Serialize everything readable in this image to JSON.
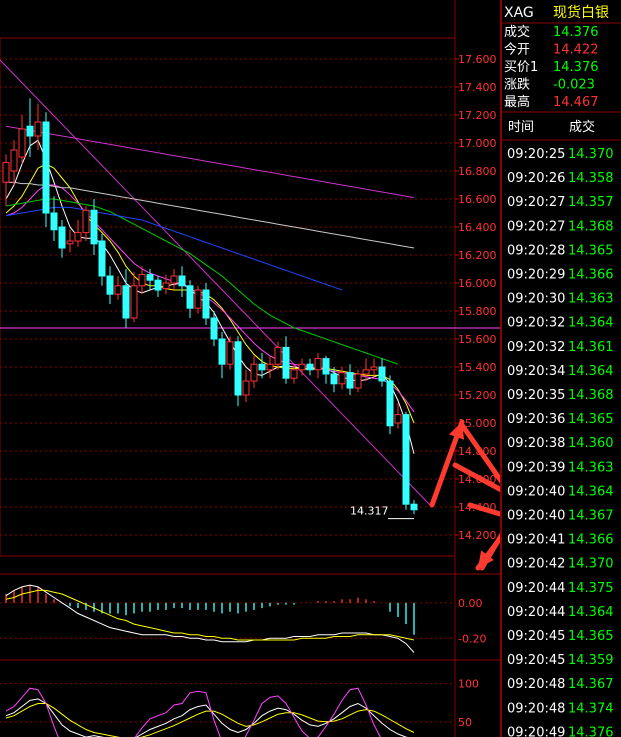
{
  "header": {
    "symbol": "XAG",
    "name": "现货白银"
  },
  "quote": [
    {
      "label": "成交",
      "value": "14.376",
      "color": "#00ff00"
    },
    {
      "label": "今开",
      "value": "14.422",
      "color": "#ff3333"
    },
    {
      "label": "买价1",
      "value": "14.376",
      "color": "#00ff00"
    },
    {
      "label": "涨跌",
      "value": "-0.023",
      "color": "#00ff00"
    },
    {
      "label": "最高",
      "value": "14.467",
      "color": "#ff3333"
    }
  ],
  "ticks": {
    "col_time": "时间",
    "col_price": "成交",
    "rows": [
      {
        "time": "09:20:25",
        "price": "14.370"
      },
      {
        "time": "09:20:26",
        "price": "14.358"
      },
      {
        "time": "09:20:27",
        "price": "14.357"
      },
      {
        "time": "09:20:27",
        "price": "14.368"
      },
      {
        "time": "09:20:28",
        "price": "14.365"
      },
      {
        "time": "09:20:29",
        "price": "14.366"
      },
      {
        "time": "09:20:30",
        "price": "14.363"
      },
      {
        "time": "09:20:32",
        "price": "14.364"
      },
      {
        "time": "09:20:32",
        "price": "14.361"
      },
      {
        "time": "09:20:34",
        "price": "14.364"
      },
      {
        "time": "09:20:35",
        "price": "14.368"
      },
      {
        "time": "09:20:36",
        "price": "14.365"
      },
      {
        "time": "09:20:38",
        "price": "14.360"
      },
      {
        "time": "09:20:39",
        "price": "14.363"
      },
      {
        "time": "09:20:40",
        "price": "14.364"
      },
      {
        "time": "09:20:40",
        "price": "14.367"
      },
      {
        "time": "09:20:41",
        "price": "14.366"
      },
      {
        "time": "09:20:42",
        "price": "14.370"
      },
      {
        "time": "09:20:44",
        "price": "14.375"
      },
      {
        "time": "09:20:44",
        "price": "14.364"
      },
      {
        "time": "09:20:45",
        "price": "14.365"
      },
      {
        "time": "09:20:45",
        "price": "14.359"
      },
      {
        "time": "09:20:48",
        "price": "14.367"
      },
      {
        "time": "09:20:48",
        "price": "14.374"
      },
      {
        "time": "09:20:49",
        "price": "14.376"
      }
    ]
  },
  "chart_data": {
    "type": "candlestick",
    "ylim": [
      14.05,
      17.75
    ],
    "y_ticks": [
      "17.600",
      "17.400",
      "17.200",
      "17.000",
      "16.800",
      "16.600",
      "16.400",
      "16.200",
      "16.000",
      "15.800",
      "15.600",
      "15.400",
      "15.200",
      "15.000",
      "14.800",
      "14.600",
      "14.400",
      "14.200"
    ],
    "last_price_label": "14.317",
    "candles": [
      [
        16.72,
        16.86,
        16.55,
        16.92
      ],
      [
        16.8,
        16.95,
        16.7,
        17.02
      ],
      [
        16.9,
        17.1,
        16.85,
        17.2
      ],
      [
        17.12,
        17.05,
        16.9,
        17.32
      ],
      [
        17.05,
        17.15,
        16.95,
        17.28
      ],
      [
        17.15,
        16.5,
        16.4,
        17.22
      ],
      [
        16.5,
        16.38,
        16.3,
        16.62
      ],
      [
        16.4,
        16.25,
        16.18,
        16.45
      ],
      [
        16.28,
        16.3,
        16.22,
        16.38
      ],
      [
        16.3,
        16.36,
        16.26,
        16.45
      ],
      [
        16.36,
        16.52,
        16.3,
        16.55
      ],
      [
        16.52,
        16.28,
        16.2,
        16.6
      ],
      [
        16.3,
        16.05,
        15.98,
        16.35
      ],
      [
        16.05,
        15.92,
        15.85,
        16.12
      ],
      [
        15.92,
        15.98,
        15.88,
        16.05
      ],
      [
        15.98,
        15.75,
        15.68,
        16.1
      ],
      [
        15.75,
        15.98,
        15.72,
        16.08
      ],
      [
        15.98,
        16.06,
        15.92,
        16.12
      ],
      [
        16.06,
        16.02,
        15.95,
        16.1
      ],
      [
        16.02,
        15.95,
        15.9,
        16.05
      ],
      [
        15.96,
        16.0,
        15.92,
        16.06
      ],
      [
        16.0,
        16.05,
        15.95,
        16.1
      ],
      [
        16.05,
        15.98,
        15.9,
        16.12
      ],
      [
        15.98,
        15.82,
        15.75,
        16.02
      ],
      [
        15.82,
        15.95,
        15.78,
        15.98
      ],
      [
        15.95,
        15.75,
        15.7,
        16.0
      ],
      [
        15.75,
        15.6,
        15.55,
        15.8
      ],
      [
        15.6,
        15.42,
        15.32,
        15.65
      ],
      [
        15.42,
        15.58,
        15.38,
        15.62
      ],
      [
        15.58,
        15.2,
        15.12,
        15.62
      ],
      [
        15.2,
        15.3,
        15.15,
        15.38
      ],
      [
        15.3,
        15.42,
        15.25,
        15.48
      ],
      [
        15.42,
        15.38,
        15.32,
        15.5
      ],
      [
        15.38,
        15.42,
        15.32,
        15.48
      ],
      [
        15.42,
        15.54,
        15.38,
        15.58
      ],
      [
        15.54,
        15.32,
        15.28,
        15.62
      ],
      [
        15.32,
        15.38,
        15.28,
        15.42
      ],
      [
        15.38,
        15.42,
        15.34,
        15.46
      ],
      [
        15.42,
        15.38,
        15.34,
        15.46
      ],
      [
        15.38,
        15.46,
        15.32,
        15.5
      ],
      [
        15.46,
        15.35,
        15.28,
        15.48
      ],
      [
        15.35,
        15.28,
        15.22,
        15.4
      ],
      [
        15.28,
        15.36,
        15.24,
        15.4
      ],
      [
        15.36,
        15.25,
        15.2,
        15.42
      ],
      [
        15.25,
        15.35,
        15.22,
        15.38
      ],
      [
        15.35,
        15.38,
        15.3,
        15.46
      ],
      [
        15.38,
        15.4,
        15.32,
        15.46
      ],
      [
        15.4,
        15.3,
        15.26,
        15.46
      ],
      [
        15.3,
        14.98,
        14.92,
        15.34
      ],
      [
        15.0,
        15.06,
        14.96,
        15.14
      ],
      [
        15.06,
        14.42,
        14.38,
        15.08
      ],
      [
        14.42,
        14.38,
        14.35,
        14.45
      ]
    ],
    "ma_lines": [
      {
        "color": "#ffffff",
        "values": [
          16.6,
          16.7,
          16.85,
          16.98,
          17.02,
          16.88,
          16.72,
          16.55,
          16.4,
          16.33,
          16.32,
          16.32,
          16.28,
          16.2,
          16.1,
          16.0,
          15.95,
          15.93,
          15.95,
          15.97,
          15.98,
          15.99,
          16.0,
          15.96,
          15.9,
          15.86,
          15.79,
          15.68,
          15.58,
          15.48,
          15.4,
          15.35,
          15.34,
          15.37,
          15.4,
          15.41,
          15.4,
          15.39,
          15.38,
          15.39,
          15.39,
          15.36,
          15.33,
          15.31,
          15.3,
          15.31,
          15.33,
          15.35,
          15.28,
          15.16,
          15.0,
          14.78
        ]
      },
      {
        "color": "#ffff00",
        "values": [
          16.5,
          16.55,
          16.62,
          16.72,
          16.82,
          16.85,
          16.82,
          16.75,
          16.68,
          16.58,
          16.48,
          16.42,
          16.36,
          16.3,
          16.22,
          16.12,
          16.05,
          16.0,
          15.98,
          15.98,
          15.96,
          15.95,
          15.95,
          15.95,
          15.94,
          15.92,
          15.88,
          15.82,
          15.74,
          15.65,
          15.56,
          15.49,
          15.44,
          15.41,
          15.4,
          15.39,
          15.39,
          15.39,
          15.39,
          15.39,
          15.39,
          15.38,
          15.37,
          15.36,
          15.35,
          15.34,
          15.34,
          15.34,
          15.31,
          15.24,
          15.14,
          15.0
        ]
      },
      {
        "color": "#ff44ff",
        "values": [
          16.48,
          16.5,
          16.54,
          16.6,
          16.66,
          16.7,
          16.7,
          16.68,
          16.63,
          16.57,
          16.5,
          16.44,
          16.38,
          16.32,
          16.26,
          16.2,
          16.14,
          16.1,
          16.07,
          16.05,
          16.03,
          16.01,
          15.99,
          15.96,
          15.93,
          15.9,
          15.86,
          15.81,
          15.75,
          15.69,
          15.63,
          15.57,
          15.52,
          15.48,
          15.45,
          15.43,
          15.42,
          15.41,
          15.4,
          15.39,
          15.38,
          15.37,
          15.36,
          15.35,
          15.34,
          15.33,
          15.32,
          15.31,
          15.28,
          15.23,
          15.16,
          15.08
        ]
      },
      {
        "color": "#00cc00",
        "values": [
          16.55,
          16.56,
          16.57,
          16.58,
          16.59,
          16.6,
          16.6,
          16.59,
          16.58,
          16.57,
          16.56,
          16.55,
          16.53,
          16.51,
          16.48,
          16.45,
          16.42,
          16.39,
          16.36,
          16.33,
          16.3,
          16.27,
          16.24,
          16.21,
          16.17,
          16.13,
          16.09,
          16.05,
          16.0,
          15.95,
          15.9,
          15.85,
          15.81,
          15.77,
          15.74,
          15.71,
          15.68,
          15.66,
          15.64,
          15.62,
          15.6,
          15.58,
          15.56,
          15.54,
          15.52,
          15.5,
          15.48,
          15.46,
          15.44,
          15.42
        ]
      },
      {
        "color": "#2244ff",
        "values": [
          16.48,
          16.49,
          16.5,
          16.51,
          16.52,
          16.53,
          16.54,
          16.54,
          16.54,
          16.53,
          16.52,
          16.51,
          16.5,
          16.49,
          16.48,
          16.47,
          16.46,
          16.45,
          16.43,
          16.41,
          16.39,
          16.37,
          16.35,
          16.33,
          16.31,
          16.29,
          16.27,
          16.25,
          16.23,
          16.21,
          16.19,
          16.17,
          16.15,
          16.13,
          16.11,
          16.09,
          16.07,
          16.05,
          16.03,
          16.01,
          15.99,
          15.97,
          15.95
        ]
      },
      {
        "color": "#c8c8c8",
        "values": [
          16.72,
          16.72,
          16.71,
          16.71,
          16.7,
          16.7,
          16.69,
          16.68,
          16.68,
          16.67,
          16.66,
          16.65,
          16.64,
          16.63,
          16.62,
          16.61,
          16.6,
          16.59,
          16.58,
          16.57,
          16.56,
          16.55,
          16.54,
          16.53,
          16.52,
          16.51,
          16.5,
          16.49,
          16.48,
          16.47,
          16.46,
          16.45,
          16.44,
          16.43,
          16.42,
          16.41,
          16.4,
          16.39,
          16.38,
          16.37,
          16.36,
          16.35,
          16.34,
          16.33,
          16.32,
          16.31,
          16.3,
          16.29,
          16.28,
          16.27,
          16.26,
          16.25
        ]
      },
      {
        "color": "#cc33cc",
        "values": [
          17.12,
          17.11,
          17.1,
          17.09,
          17.08,
          17.07,
          17.06,
          17.05,
          17.04,
          17.03,
          17.02,
          17.01,
          17.0,
          16.99,
          16.98,
          16.97,
          16.96,
          16.95,
          16.94,
          16.93,
          16.92,
          16.91,
          16.9,
          16.89,
          16.88,
          16.87,
          16.86,
          16.85,
          16.84,
          16.83,
          16.82,
          16.81,
          16.8,
          16.79,
          16.78,
          16.77,
          16.76,
          16.75,
          16.74,
          16.73,
          16.72,
          16.71,
          16.7,
          16.69,
          16.68,
          16.67,
          16.66,
          16.65,
          16.64,
          16.63,
          16.62,
          16.61
        ]
      }
    ],
    "macd": {
      "y_ticks": [
        "0.00",
        "-0.20"
      ],
      "ylim": [
        -0.3,
        0.14
      ],
      "hist": [
        0.05,
        0.07,
        0.09,
        0.1,
        0.09,
        0.05,
        0.02,
        0.0,
        -0.02,
        -0.03,
        -0.04,
        -0.05,
        -0.06,
        -0.06,
        -0.06,
        -0.07,
        -0.06,
        -0.05,
        -0.05,
        -0.04,
        -0.04,
        -0.03,
        -0.03,
        -0.04,
        -0.04,
        -0.04,
        -0.05,
        -0.06,
        -0.05,
        -0.06,
        -0.05,
        -0.04,
        -0.03,
        -0.02,
        -0.01,
        -0.01,
        -0.01,
        0.0,
        0.0,
        0.01,
        0.01,
        0.01,
        0.02,
        0.02,
        0.03,
        0.02,
        0.01,
        0.0,
        -0.05,
        -0.08,
        -0.12,
        -0.18
      ],
      "dif": [
        0.04,
        0.07,
        0.09,
        0.1,
        0.09,
        0.06,
        0.03,
        0.0,
        -0.03,
        -0.06,
        -0.08,
        -0.1,
        -0.12,
        -0.14,
        -0.15,
        -0.16,
        -0.17,
        -0.18,
        -0.18,
        -0.18,
        -0.18,
        -0.19,
        -0.19,
        -0.2,
        -0.2,
        -0.21,
        -0.21,
        -0.22,
        -0.22,
        -0.22,
        -0.22,
        -0.21,
        -0.21,
        -0.2,
        -0.2,
        -0.2,
        -0.19,
        -0.19,
        -0.19,
        -0.18,
        -0.18,
        -0.18,
        -0.17,
        -0.17,
        -0.17,
        -0.17,
        -0.18,
        -0.18,
        -0.19,
        -0.2,
        -0.23,
        -0.28
      ],
      "dea": [
        0.02,
        0.03,
        0.05,
        0.06,
        0.07,
        0.07,
        0.06,
        0.05,
        0.03,
        0.01,
        -0.01,
        -0.03,
        -0.05,
        -0.07,
        -0.09,
        -0.1,
        -0.12,
        -0.13,
        -0.14,
        -0.15,
        -0.16,
        -0.17,
        -0.17,
        -0.18,
        -0.18,
        -0.19,
        -0.19,
        -0.2,
        -0.2,
        -0.21,
        -0.21,
        -0.21,
        -0.21,
        -0.21,
        -0.21,
        -0.21,
        -0.21,
        -0.2,
        -0.2,
        -0.2,
        -0.2,
        -0.19,
        -0.19,
        -0.19,
        -0.18,
        -0.18,
        -0.18,
        -0.18,
        -0.18,
        -0.19,
        -0.2,
        -0.21
      ]
    },
    "kdj": {
      "y_ticks": [
        "100",
        "50"
      ],
      "ylim": [
        0,
        110
      ],
      "k": [
        58,
        62,
        70,
        78,
        80,
        74,
        60,
        46,
        38,
        34,
        30,
        32,
        30,
        28,
        26,
        24,
        28,
        34,
        40,
        44,
        48,
        54,
        58,
        66,
        70,
        72,
        60,
        48,
        40,
        36,
        40,
        48,
        58,
        64,
        68,
        66,
        60,
        52,
        46,
        44,
        48,
        54,
        62,
        70,
        74,
        68,
        58,
        48,
        40,
        34,
        30,
        28
      ],
      "d": [
        55,
        58,
        64,
        70,
        74,
        74,
        68,
        60,
        52,
        46,
        40,
        36,
        34,
        32,
        30,
        28,
        28,
        30,
        33,
        37,
        41,
        45,
        50,
        55,
        60,
        64,
        64,
        60,
        54,
        48,
        44,
        46,
        50,
        55,
        60,
        62,
        62,
        59,
        55,
        51,
        50,
        51,
        54,
        59,
        64,
        66,
        64,
        59,
        53,
        47,
        41,
        36
      ],
      "j": [
        64,
        70,
        82,
        94,
        92,
        74,
        44,
        18,
        10,
        10,
        10,
        24,
        22,
        20,
        18,
        16,
        28,
        42,
        54,
        58,
        62,
        72,
        74,
        88,
        90,
        88,
        52,
        24,
        12,
        12,
        32,
        52,
        74,
        82,
        84,
        74,
        56,
        38,
        28,
        30,
        44,
        60,
        78,
        92,
        94,
        72,
        46,
        26,
        14,
        8,
        8,
        12
      ]
    }
  }
}
